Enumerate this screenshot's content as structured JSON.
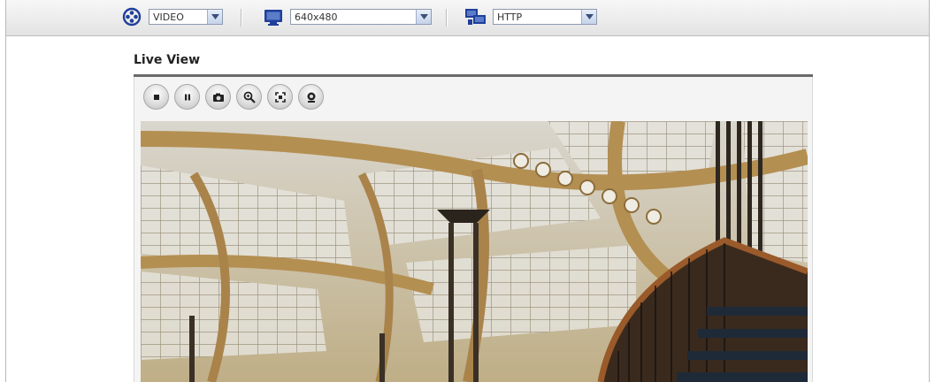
{
  "toolbar": {
    "stream_type": {
      "selected": "VIDEO",
      "icon": "video-reel-icon"
    },
    "resolution": {
      "selected": "640x480",
      "icon": "monitor-icon"
    },
    "protocol": {
      "selected": "HTTP",
      "icon": "network-computer-icon"
    }
  },
  "main": {
    "title": "Live View",
    "controls": [
      {
        "name": "stop-button",
        "icon": "stop-icon"
      },
      {
        "name": "pause-button",
        "icon": "pause-icon"
      },
      {
        "name": "snapshot-button",
        "icon": "camera-icon"
      },
      {
        "name": "zoom-button",
        "icon": "magnifier-zoom-icon"
      },
      {
        "name": "fullscreen-button",
        "icon": "fullscreen-icon"
      },
      {
        "name": "record-button",
        "icon": "record-icon"
      }
    ],
    "video": {
      "description_icon": "live-video-frame"
    }
  },
  "colors": {
    "accent_blue": "#1f3f9a",
    "title_rule": "#6a6a6a"
  }
}
